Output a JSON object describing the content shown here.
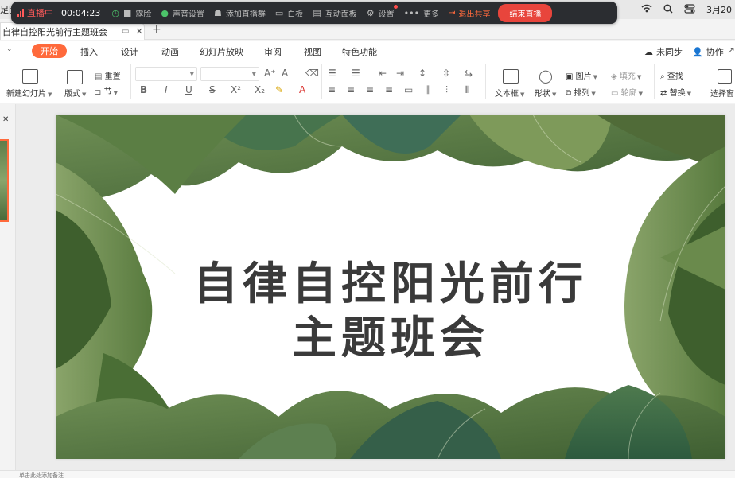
{
  "menubar": {
    "left_text": "足图",
    "date": "3月20",
    "icons": [
      "wifi-icon",
      "search-icon",
      "control-center-icon"
    ]
  },
  "livebar": {
    "status": "直播中",
    "timer": "00:04:23",
    "items": [
      {
        "icon": "camera-icon",
        "label": "露脸"
      },
      {
        "icon": "microphone-icon",
        "label": "声音设置"
      },
      {
        "icon": "add-group-icon",
        "label": "添加直播群"
      },
      {
        "icon": "whiteboard-icon",
        "label": "白板"
      },
      {
        "icon": "chat-icon",
        "label": "互动面板"
      },
      {
        "icon": "gear-icon",
        "label": "设置"
      },
      {
        "icon": "more-icon",
        "label": "更多"
      }
    ],
    "exit_label": "退出共享",
    "end_label": "结束直播",
    "accent": "#e8453c"
  },
  "document": {
    "tab_title": "自律自控阳光前行主题班会",
    "new_tab": "+"
  },
  "ribbon_tabs": {
    "items": [
      "开始",
      "插入",
      "设计",
      "动画",
      "幻灯片放映",
      "审阅",
      "视图",
      "特色功能"
    ],
    "active": "开始",
    "right": {
      "sync": "未同步",
      "collab": "协作"
    }
  },
  "ribbon": {
    "new_slide": "新建幻灯片",
    "layout": "版式",
    "reset": "重置",
    "section": "节",
    "text_box": "文本框",
    "shape": "形状",
    "picture": "图片",
    "fill": "填充",
    "arrange": "排列",
    "outline": "轮廓",
    "find": "查找",
    "replace": "替换",
    "select_pane": "选择窗",
    "font_buttons": [
      "B",
      "I",
      "U",
      "S",
      "X²",
      "X₂"
    ]
  },
  "slide": {
    "title_line1": "自律自控阳光前行",
    "title_line2": "主题班会",
    "title_color": "#3a3a3a",
    "leaf_color": "#4f6f3c"
  },
  "notes": {
    "placeholder": "单击此处添加备注"
  }
}
